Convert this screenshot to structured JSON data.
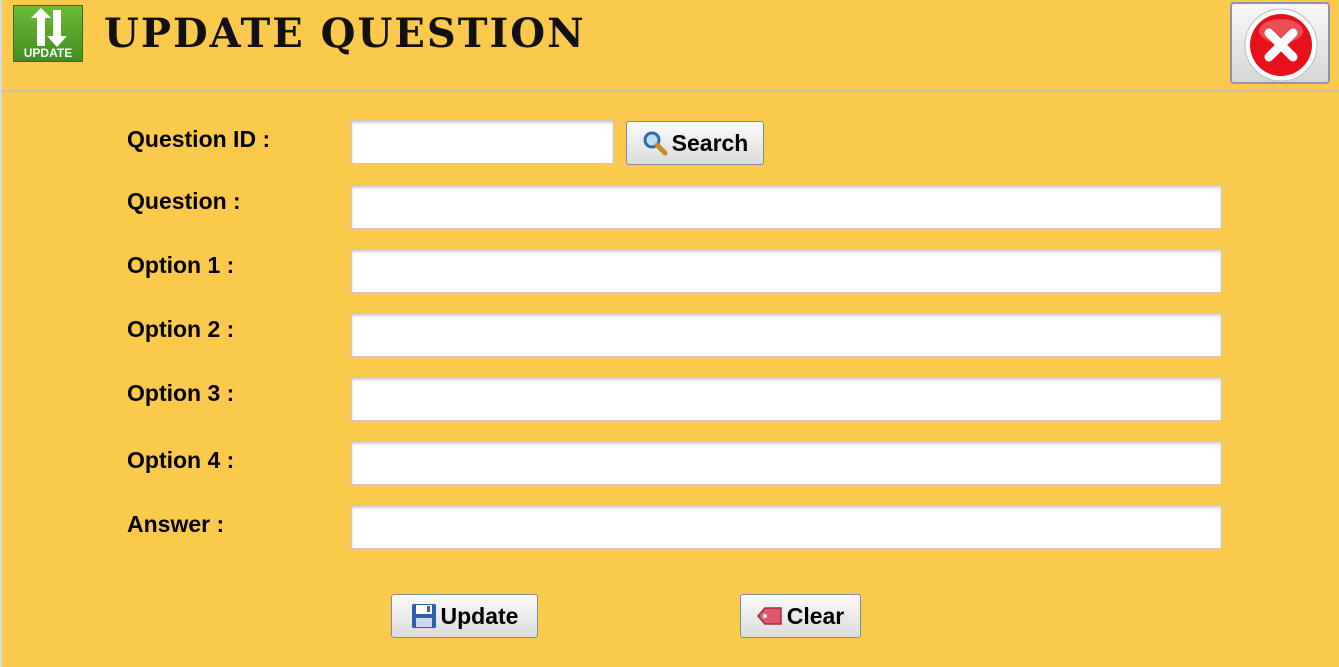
{
  "window": {
    "title": "UPDATE QUESTION",
    "icon_label": "UPDATE",
    "icon": "update-arrows-icon",
    "close_icon": "close-icon"
  },
  "form": {
    "question_id": {
      "label": "Question ID :",
      "value": ""
    },
    "search_button": {
      "label": "Search",
      "icon": "search-icon"
    },
    "question": {
      "label": "Question :",
      "value": ""
    },
    "option1": {
      "label": "Option 1 :",
      "value": ""
    },
    "option2": {
      "label": "Option 2 :",
      "value": ""
    },
    "option3": {
      "label": "Option 3 :",
      "value": ""
    },
    "option4": {
      "label": "Option 4 :",
      "value": ""
    },
    "answer": {
      "label": "Answer :",
      "value": ""
    }
  },
  "actions": {
    "update": {
      "label": "Update",
      "icon": "save-icon"
    },
    "clear": {
      "label": "Clear",
      "icon": "eraser-icon"
    }
  },
  "colors": {
    "background": "#fbca4c",
    "close_red": "#e8101a",
    "icon_green": "#4ea52a"
  }
}
